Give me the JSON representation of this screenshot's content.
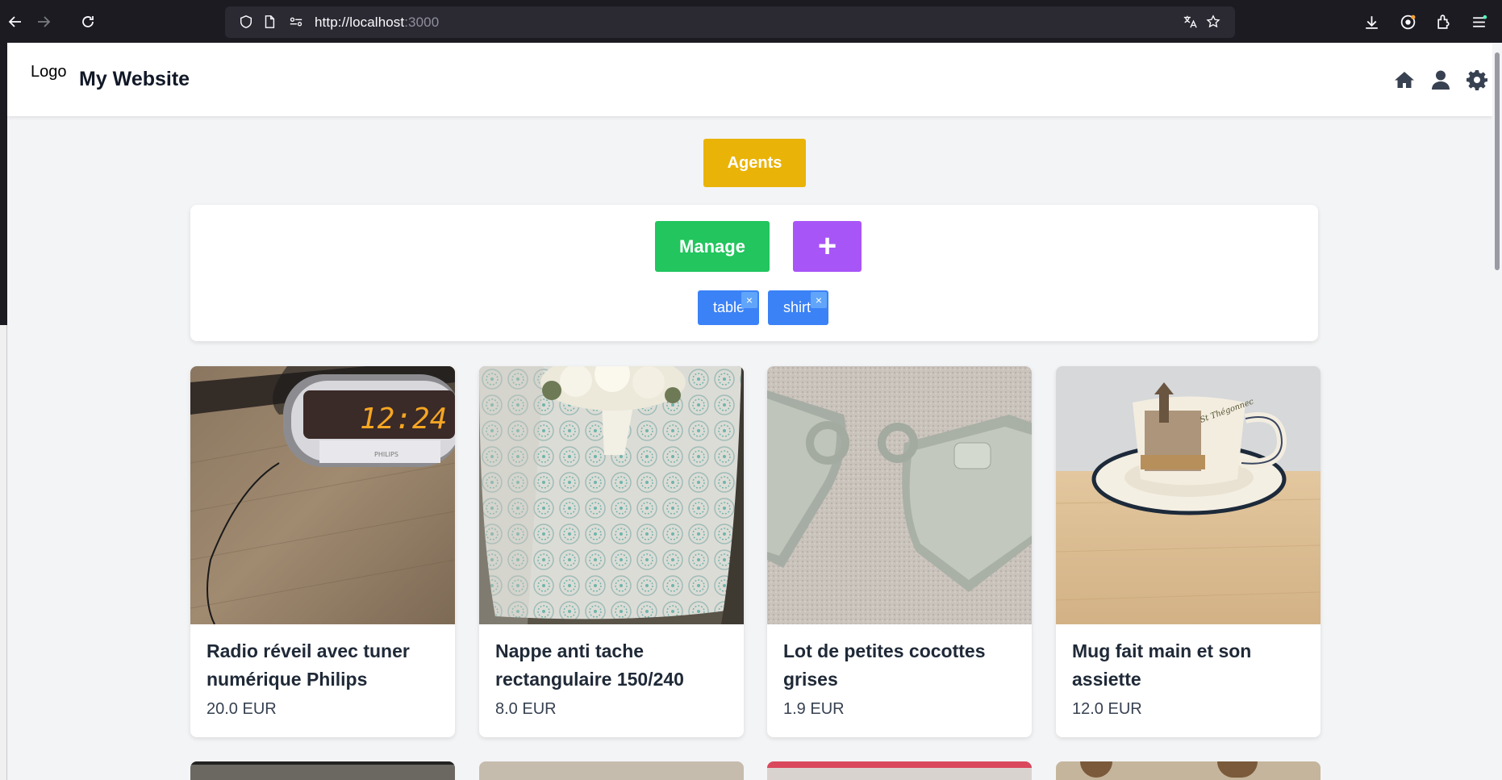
{
  "browser": {
    "url_host": "http://localhost",
    "url_port": ":3000"
  },
  "header": {
    "logo_text": "Logo",
    "site_title": "My Website"
  },
  "actions": {
    "agents_label": "Agents",
    "manage_label": "Manage",
    "add_label": "+"
  },
  "tags": [
    {
      "label": "table",
      "remove": "×"
    },
    {
      "label": "shirt",
      "remove": "×"
    }
  ],
  "products": [
    {
      "title": "Radio réveil avec tuner numérique Philips",
      "price": "20.0 EUR",
      "image": "alarm-clock-radio-photo"
    },
    {
      "title": "Nappe anti tache rectangulaire 150/240",
      "price": "8.0 EUR",
      "image": "tablecloth-photo"
    },
    {
      "title": "Lot de petites cocottes grises",
      "price": "1.9 EUR",
      "image": "grey-cocottes-photo"
    },
    {
      "title": "Mug fait main et son assiette",
      "price": "12.0 EUR",
      "image": "mug-and-saucer-photo"
    }
  ],
  "colors": {
    "agents": "#eab308",
    "manage": "#22c55e",
    "add": "#a855f7",
    "tag": "#3b82f6"
  }
}
